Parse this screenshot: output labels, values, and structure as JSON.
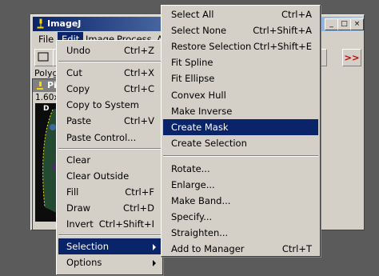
{
  "window": {
    "title": "ImageJ"
  },
  "menubar": {
    "file": "File",
    "edit": "Edit",
    "image": "Image",
    "process": "Process",
    "analyze": "A"
  },
  "status": "Polyg",
  "image_window": {
    "title": "Pin",
    "info": "1.60x1",
    "corner_label": "D"
  },
  "toolbar": {
    "more_label": ">>"
  },
  "edit_menu": {
    "groups": [
      [
        {
          "label": "Undo",
          "accel": "Ctrl+Z"
        }
      ],
      [
        {
          "label": "Cut",
          "accel": "Ctrl+X"
        },
        {
          "label": "Copy",
          "accel": "Ctrl+C"
        },
        {
          "label": "Copy to System",
          "accel": ""
        },
        {
          "label": "Paste",
          "accel": "Ctrl+V"
        },
        {
          "label": "Paste Control...",
          "accel": ""
        }
      ],
      [
        {
          "label": "Clear",
          "accel": ""
        },
        {
          "label": "Clear Outside",
          "accel": ""
        },
        {
          "label": "Fill",
          "accel": "Ctrl+F"
        },
        {
          "label": "Draw",
          "accel": "Ctrl+D"
        },
        {
          "label": "Invert",
          "accel": "Ctrl+Shift+I"
        }
      ],
      [
        {
          "label": "Selection",
          "accel": "",
          "submenu": true,
          "highlighted": true
        },
        {
          "label": "Options",
          "accel": "",
          "submenu": true
        }
      ]
    ]
  },
  "selection_menu": {
    "groups": [
      [
        {
          "label": "Select All",
          "accel": "Ctrl+A"
        },
        {
          "label": "Select None",
          "accel": "Ctrl+Shift+A"
        },
        {
          "label": "Restore Selection",
          "accel": "Ctrl+Shift+E"
        },
        {
          "label": "Fit Spline",
          "accel": ""
        },
        {
          "label": "Fit Ellipse",
          "accel": ""
        },
        {
          "label": "Convex Hull",
          "accel": ""
        },
        {
          "label": "Make Inverse",
          "accel": ""
        },
        {
          "label": "Create Mask",
          "accel": "",
          "highlighted": true
        },
        {
          "label": "Create Selection",
          "accel": ""
        }
      ],
      [
        {
          "label": "Rotate...",
          "accel": ""
        },
        {
          "label": "Enlarge...",
          "accel": ""
        },
        {
          "label": "Make Band...",
          "accel": ""
        },
        {
          "label": "Specify...",
          "accel": ""
        },
        {
          "label": "Straighten...",
          "accel": ""
        },
        {
          "label": "Add to Manager",
          "accel": "Ctrl+T"
        }
      ]
    ]
  }
}
